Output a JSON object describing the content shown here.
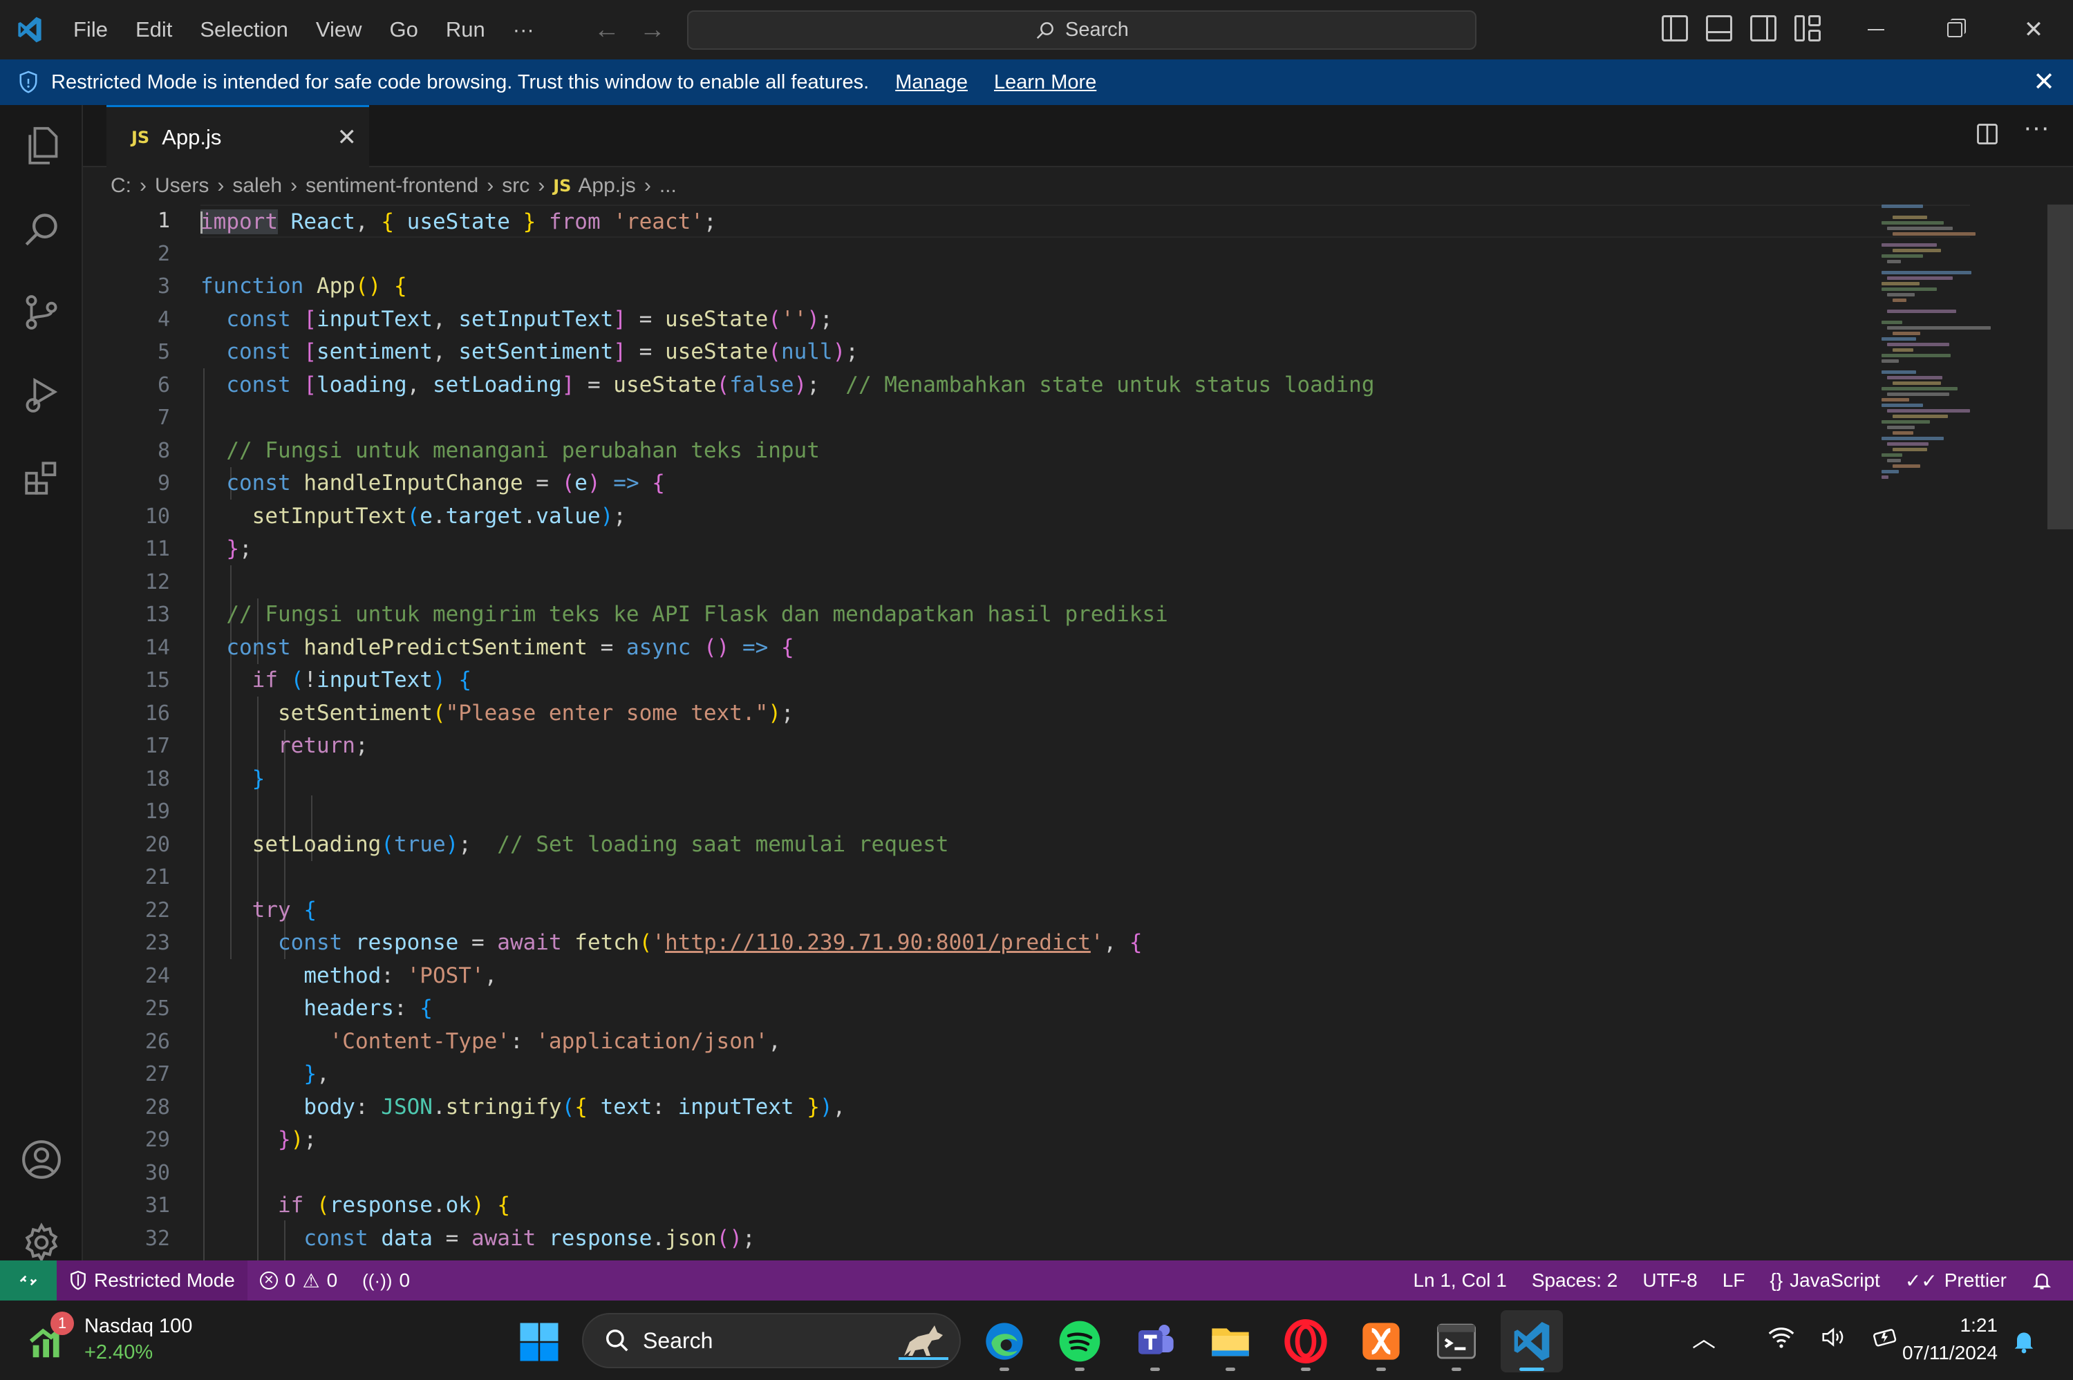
{
  "titlebar": {
    "menu": [
      "File",
      "Edit",
      "Selection",
      "View",
      "Go",
      "Run",
      "···"
    ],
    "search_placeholder": "Search"
  },
  "banner": {
    "message": "Restricted Mode is intended for safe code browsing. Trust this window to enable all features.",
    "manage_link": "Manage",
    "learn_more_link": "Learn More"
  },
  "tab": {
    "badge": "JS",
    "label": "App.js"
  },
  "breadcrumb": [
    "C:",
    "Users",
    "saleh",
    "sentiment-frontend",
    "src",
    "App.js",
    "..."
  ],
  "editor": {
    "line_numbers": [
      "1",
      "2",
      "3",
      "4",
      "5",
      "6",
      "7",
      "8",
      "9",
      "10",
      "11",
      "12",
      "13",
      "14",
      "15",
      "16",
      "17",
      "18",
      "19",
      "20",
      "21",
      "22",
      "23",
      "24",
      "25",
      "26",
      "27",
      "28",
      "29",
      "30",
      "31",
      "32"
    ],
    "active_line": 1,
    "language": "JavaScript"
  },
  "statusbar": {
    "restricted": "Restricted Mode",
    "errors": "0",
    "warnings": "0",
    "ports": "0",
    "position": "Ln 1, Col 1",
    "spaces": "Spaces: 2",
    "encoding": "UTF-8",
    "eol": "LF",
    "language": "JavaScript",
    "formatter": "Prettier"
  },
  "taskbar": {
    "widget_title": "Nasdaq 100",
    "widget_change": "+2.40%",
    "widget_badge": "1",
    "search_placeholder": "Search",
    "time": "1:21",
    "date": "07/11/2024"
  },
  "colors": {
    "banner": "#063b72",
    "statusbar": "#68217a",
    "remote": "#16825d",
    "accent": "#0078d4"
  }
}
